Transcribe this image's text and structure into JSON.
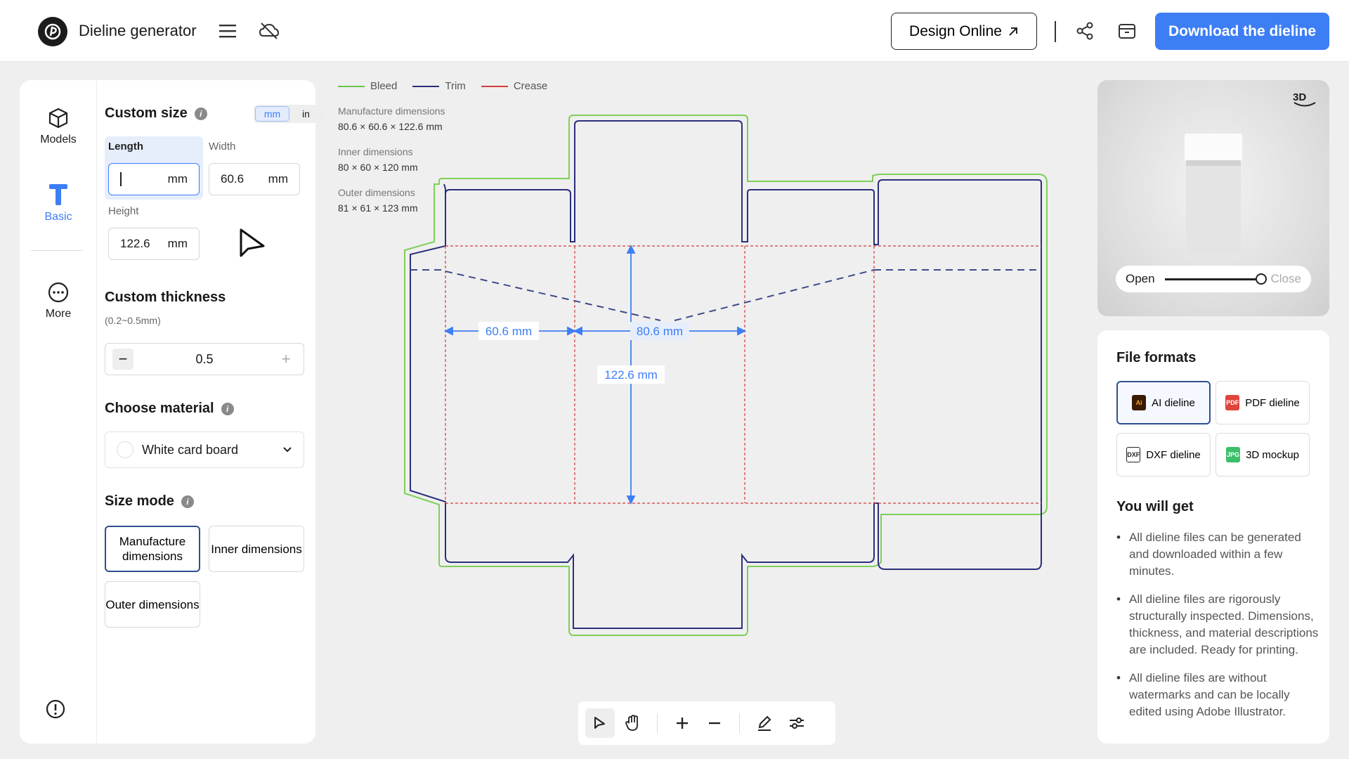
{
  "header": {
    "app_title": "Dieline generator",
    "design_online_label": "Design Online",
    "download_label": "Download the dieline"
  },
  "rail": {
    "items": [
      {
        "label": "Models",
        "icon": "cube-icon"
      },
      {
        "label": "Basic",
        "icon": "ruler-t-icon",
        "active": true
      },
      {
        "label": "More",
        "icon": "more-icon"
      }
    ]
  },
  "custom_size": {
    "title": "Custom size",
    "units": [
      "mm",
      "in"
    ],
    "selected_unit": "mm",
    "length": {
      "label": "Length",
      "value": "",
      "unit": "mm"
    },
    "width": {
      "label": "Width",
      "value": "60.6",
      "unit": "mm"
    },
    "height": {
      "label": "Height",
      "value": "122.6",
      "unit": "mm"
    }
  },
  "thickness": {
    "title": "Custom thickness",
    "range": "(0.2~0.5mm)",
    "value": "0.5",
    "minus": "−",
    "plus": "+"
  },
  "material": {
    "title": "Choose material",
    "selected": "White card board"
  },
  "size_mode": {
    "title": "Size mode",
    "options": [
      "Manufacture dimensions",
      "Inner dimensions",
      "Outer dimensions"
    ],
    "selected": "Manufacture dimensions"
  },
  "legend": [
    {
      "label": "Bleed",
      "color": "#6cc24a"
    },
    {
      "label": "Trim",
      "color": "#2b2f7a"
    },
    {
      "label": "Crease",
      "color": "#d23b3b"
    }
  ],
  "dimensions": {
    "manufacture": {
      "label": "Manufacture dimensions",
      "value": "80.6 × 60.6 × 122.6 mm"
    },
    "inner": {
      "label": "Inner dimensions",
      "value": "80 × 60 × 120 mm"
    },
    "outer": {
      "label": "Outer dimensions",
      "value": "81 × 61 × 123 mm"
    }
  },
  "dieline_labels": {
    "width": "60.6 mm",
    "length": "80.6 mm",
    "height": "122.6 mm"
  },
  "preview": {
    "badge": "3D",
    "open_label": "Open",
    "close_label": "Close",
    "open_level": 1.0
  },
  "formats": {
    "title": "File formats",
    "items": [
      {
        "label": "AI dieline",
        "icon": "ai-file-icon",
        "color": "#3a1a00",
        "selected": true
      },
      {
        "label": "PDF dieline",
        "icon": "pdf-file-icon",
        "color": "#e1443a"
      },
      {
        "label": "DXF dieline",
        "icon": "dxf-file-icon",
        "color": "#222222"
      },
      {
        "label": "3D mockup",
        "icon": "jpg-file-icon",
        "color": "#3bbf6b"
      }
    ],
    "get_title": "You will get",
    "benefits": [
      "All dieline files can be generated and downloaded within a few minutes.",
      "All dieline files are rigorously structurally inspected. Dimensions, thickness, and material descriptions are included. Ready for printing.",
      "All dieline files are without watermarks and can be locally edited using Adobe Illustrator."
    ]
  },
  "colors": {
    "accent": "#3d7ef5",
    "selected_border": "#2e4f91"
  }
}
